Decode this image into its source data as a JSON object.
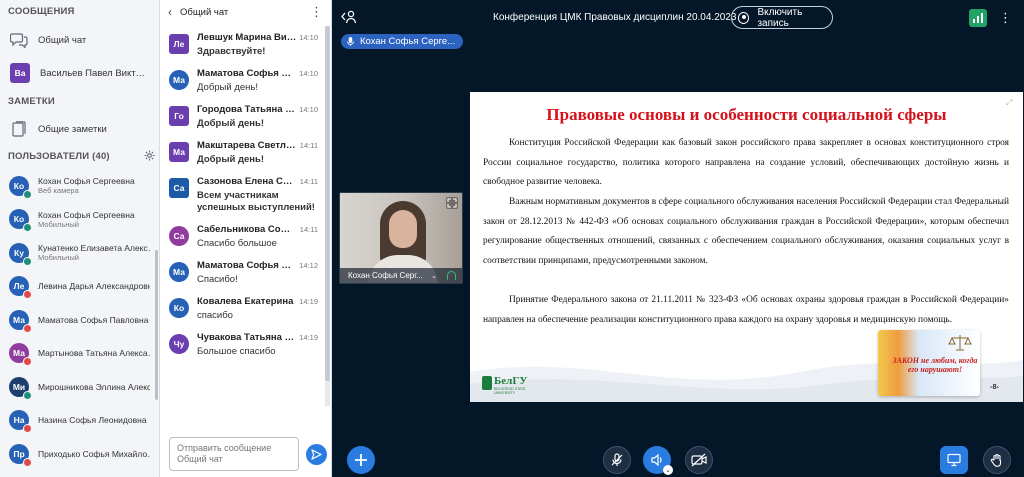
{
  "sidebar": {
    "messages_section": "СООБЩЕНИЯ",
    "general_chat": "Общий чат",
    "private_chat": {
      "initials": "Ва",
      "name": "Васильев Павел Викторович",
      "color": "#6b3fb0"
    },
    "notes_section": "ЗАМЕТКИ",
    "shared_notes": "Общие заметки",
    "users_section": "ПОЛЬЗОВАТЕЛИ (40)",
    "users": [
      {
        "initials": "Ко",
        "name": "Кохан Софья Сергеевна",
        "sub": "Веб камера",
        "color": "#2661b5",
        "badge": "teal"
      },
      {
        "initials": "Ко",
        "name": "Кохан Софья Сергеевна",
        "sub": "Мобильный",
        "color": "#2661b5",
        "badge": "teal"
      },
      {
        "initials": "Ку",
        "name": "Кунатенко Елизавета Александровна",
        "sub": "Мобильный",
        "color": "#2661b5",
        "badge": "teal"
      },
      {
        "initials": "Ле",
        "name": "Левина Дарья Александровна",
        "sub": "",
        "color": "#2661b5",
        "badge": "red"
      },
      {
        "initials": "Ма",
        "name": "Маматова Софья Павловна",
        "sub": "",
        "color": "#2661b5",
        "badge": "red"
      },
      {
        "initials": "Ма",
        "name": "Мартынова Татьяна Александровна",
        "sub": "",
        "color": "#8f3c9e",
        "badge": "red"
      },
      {
        "initials": "Ми",
        "name": "Мирошникова Эллина Александровна",
        "sub": "",
        "color": "#1c3f6e",
        "badge": "teal"
      },
      {
        "initials": "На",
        "name": "Назина Софья Леонидовна",
        "sub": "",
        "color": "#2661b5",
        "badge": "red"
      },
      {
        "initials": "Пр",
        "name": "Приходько Софья Михайловна",
        "sub": "",
        "color": "#2661b5",
        "badge": "red"
      }
    ]
  },
  "chat": {
    "title": "Общий чат",
    "input_placeholder": "Отправить сообщение Общий чат",
    "messages": [
      {
        "initials": "Ле",
        "name": "Левшук Марина Викторовна",
        "time": "14:10",
        "text": "Здравствуйте!",
        "bold": true,
        "color": "#6b3fb0",
        "square": true
      },
      {
        "initials": "Ма",
        "name": "Маматова Софья Павловна",
        "time": "14:10",
        "text": "Добрый день!",
        "bold": false,
        "color": "#2661b5",
        "square": false
      },
      {
        "initials": "Го",
        "name": "Городова Татьяна Петровна",
        "time": "14:10",
        "text": "Добрый день!",
        "bold": true,
        "color": "#6b3fb0",
        "square": true
      },
      {
        "initials": "Ма",
        "name": "Макштарева Светлана",
        "time": "14:11",
        "text": "Добрый день!",
        "bold": true,
        "color": "#6b3fb0",
        "square": true
      },
      {
        "initials": "Са",
        "name": "Сазонова Елена Сергеевна",
        "time": "14:11",
        "text": "Всем участникам успешных выступлений!",
        "bold": true,
        "color": "#1c5aa6",
        "square": true
      },
      {
        "initials": "Са",
        "name": "Сабельникова Софья",
        "time": "14:11",
        "text": "Спасибо большое",
        "bold": false,
        "color": "#8f3c9e",
        "square": false
      },
      {
        "initials": "Ма",
        "name": "Маматова Софья Павловна",
        "time": "14:12",
        "text": "Спасибо!",
        "bold": false,
        "color": "#2661b5",
        "square": false
      },
      {
        "initials": "Ко",
        "name": "Ковалева Екатерина",
        "time": "14:19",
        "text": "спасибо",
        "bold": false,
        "color": "#2661b5",
        "square": false
      },
      {
        "initials": "Чу",
        "name": "Чувакова Татьяна Сергеевна",
        "time": "14:19",
        "text": "Большое спасибо",
        "bold": false,
        "color": "#6b3fb0",
        "square": false
      }
    ]
  },
  "main": {
    "conference_title": "Конференция ЦМК Правовых дисциплин 20.04.2023",
    "record_label": "Включить запись",
    "speaker_name": "Кохан Софья Серге...",
    "camera_name": "Кохан Софья Серг...",
    "accent": "#2b7ce0"
  },
  "slide": {
    "title": "Правовые основы и особенности социальной сферы",
    "paragraphs": [
      "Конституция Российской Федерации как базовый закон российского права закрепляет в основах конституционного строя России социальное государство, политика которого направлена на создание условий, обеспечивающих достойную жизнь и свободное развитие человека.",
      "Важным нормативным документов в сфере социального обслуживания населения Российской Федерации стал Федеральный закон от 28.12.2013 № 442-ФЗ «Об основах социального обслуживания граждан в Российской Федерации», которым обеспечил регулирование общественных отношений, связанных с обеспечением социального обслуживания, оказания социальных услуг в соответствии принципами, предусмотренными законом.",
      "Принятие Федерального закона от 21.11.2011 № 323-ФЗ «Об основах охраны здоровья граждан в Российской Федерации» направлен на обеспечение реализации конституционного права каждого на охрану здоровья и медицинскую помощь."
    ],
    "logo_text": "БелГУ",
    "logo_sub": "BELGOROD STATE UNIVERSITY",
    "card_text": "ЗАКОН не любим, когда его нарушают!",
    "page": "-8-"
  }
}
